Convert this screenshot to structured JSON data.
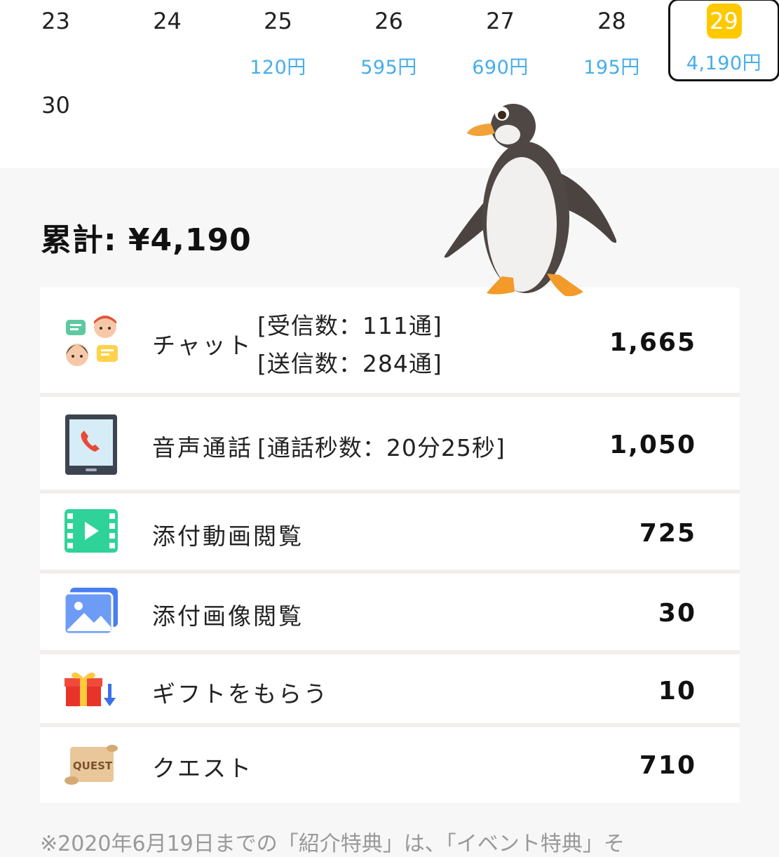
{
  "calendar": {
    "days": [
      {
        "day": "23",
        "amount": ""
      },
      {
        "day": "24",
        "amount": ""
      },
      {
        "day": "25",
        "amount": "120円"
      },
      {
        "day": "26",
        "amount": "595円"
      },
      {
        "day": "27",
        "amount": "690円"
      },
      {
        "day": "28",
        "amount": "195円"
      },
      {
        "day": "29",
        "amount": "4,190円",
        "selected": true
      },
      {
        "day": "30",
        "amount": ""
      }
    ],
    "selected_color": "#ffc900",
    "amount_color": "#45aee9"
  },
  "summary": {
    "total": "累計: ¥4,190",
    "rows": [
      {
        "icon": "chat-icon",
        "label": "チャット",
        "detail_1": "[受信数：111通]",
        "detail_2": "[送信数：284通]",
        "value": "1,665"
      },
      {
        "icon": "phone-icon",
        "label": "音声通話",
        "detail_1": "[通話秒数：20分25秒]",
        "value": "1,050"
      },
      {
        "icon": "video-icon",
        "label": "添付動画閲覧",
        "value": "725"
      },
      {
        "icon": "image-icon",
        "label": "添付画像閲覧",
        "value": "30"
      },
      {
        "icon": "gift-icon",
        "label": "ギフトをもらう",
        "value": "10"
      },
      {
        "icon": "quest-icon",
        "label": "クエスト",
        "value": "710"
      }
    ],
    "quest_icon_text": "QUEST"
  },
  "note": "※2020年6月19日までの「紹介特典」は、「イベント特典」そ"
}
